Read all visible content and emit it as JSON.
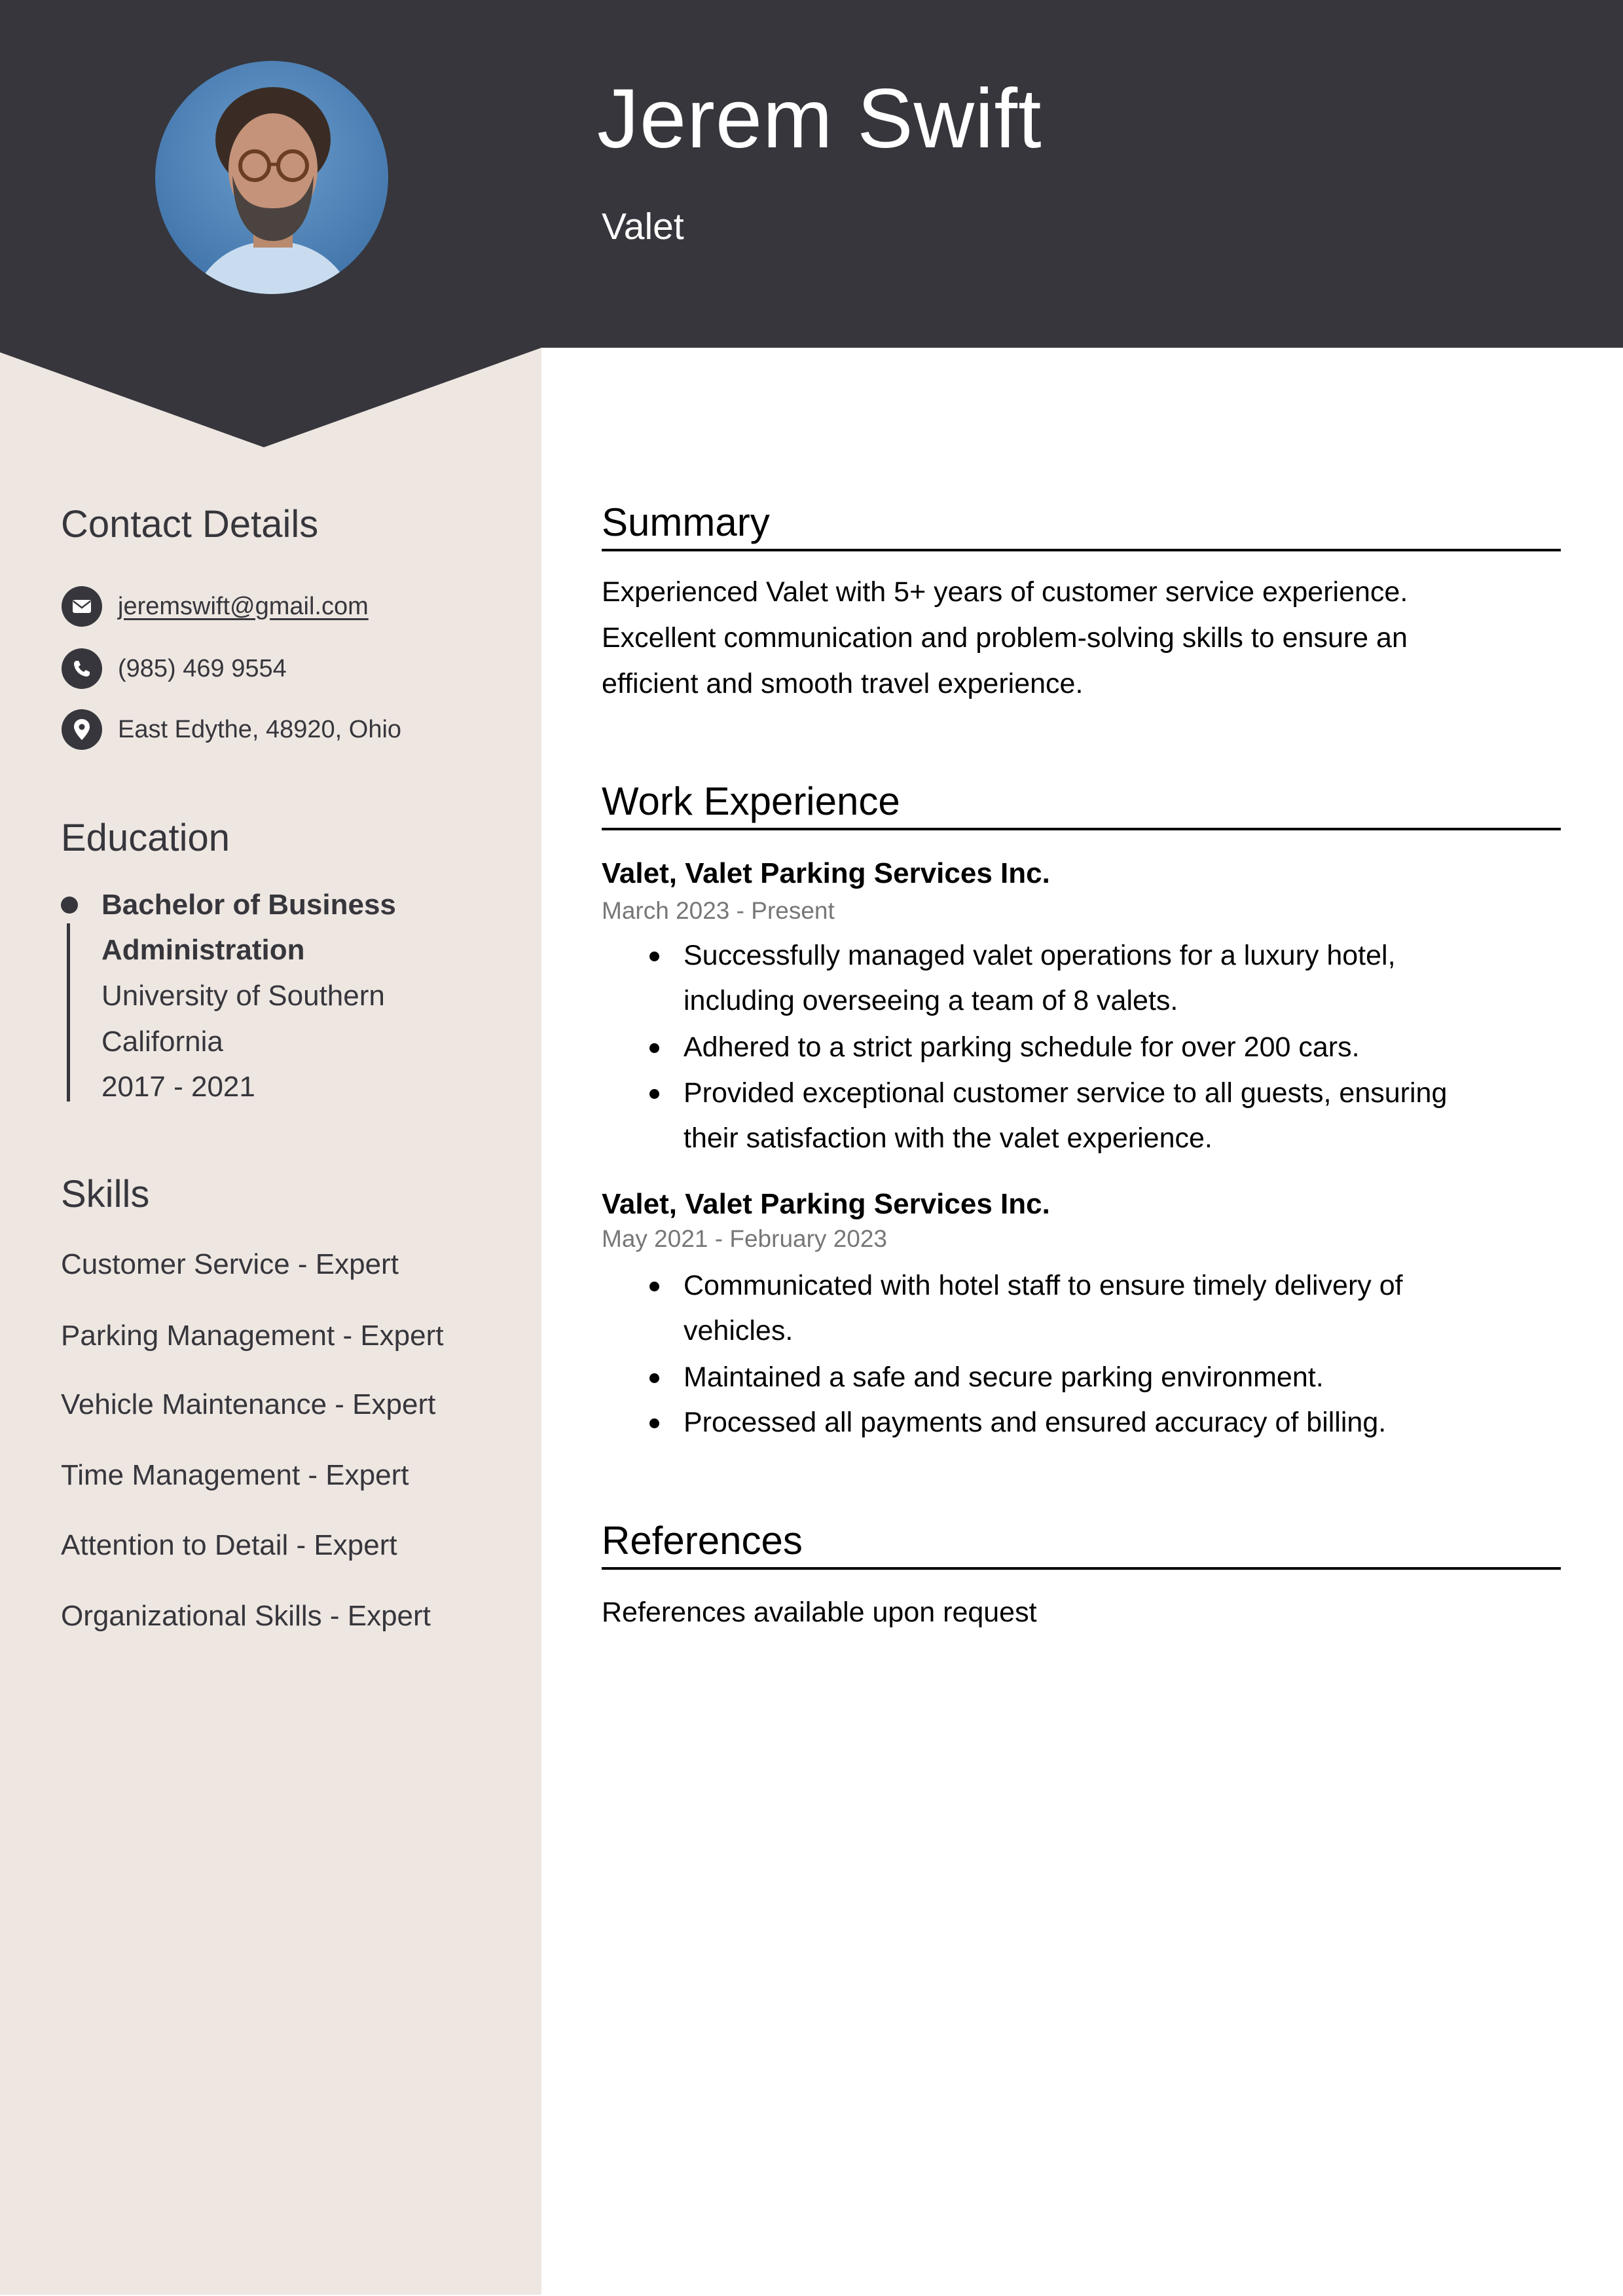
{
  "header": {
    "name": "Jerem Swift",
    "title": "Valet",
    "photo_alt": "profile-photo"
  },
  "colors": {
    "header_bg": "#36363c",
    "sidebar_bg": "#eee6e1",
    "text_dark": "#36363c",
    "date_gray": "#777777"
  },
  "sidebar": {
    "contact": {
      "heading": "Contact Details",
      "email": "jeremswift@gmail.com",
      "phone": "(985) 469 9554",
      "address": "East Edythe, 48920, Ohio"
    },
    "education": {
      "heading": "Education",
      "degree_line1": "Bachelor of Business",
      "degree_line2": "Administration",
      "school_line1": "University of Southern",
      "school_line2": "California",
      "years": "2017 - 2021"
    },
    "skills": {
      "heading": "Skills",
      "items": [
        "Customer Service - Expert",
        "Parking Management - Expert",
        "Vehicle Maintenance - Expert",
        "Time Management - Expert",
        "Attention to Detail - Expert",
        "Organizational Skills - Expert"
      ]
    }
  },
  "main": {
    "summary": {
      "heading": "Summary",
      "lines": [
        "Experienced Valet with 5+ years of customer service experience.",
        "Excellent communication and problem-solving skills to ensure an",
        "efficient and smooth travel experience."
      ]
    },
    "work": {
      "heading": "Work Experience",
      "jobs": [
        {
          "title": "Valet, Valet Parking Services Inc.",
          "dates": "March 2023 - Present",
          "bullets": [
            [
              "Successfully managed valet operations for a luxury hotel,",
              "including overseeing a team of 8 valets."
            ],
            [
              "Adhered to a strict parking schedule for over 200 cars."
            ],
            [
              "Provided exceptional customer service to all guests, ensuring",
              "their satisfaction with the valet experience."
            ]
          ]
        },
        {
          "title": "Valet, Valet Parking Services Inc.",
          "dates": "May 2021 - February 2023",
          "bullets": [
            [
              "Communicated with hotel staff to ensure timely delivery of",
              "vehicles."
            ],
            [
              "Maintained a safe and secure parking environment."
            ],
            [
              "Processed all payments and ensured accuracy of billing."
            ]
          ]
        }
      ]
    },
    "references": {
      "heading": "References",
      "text": "References available upon request"
    }
  }
}
